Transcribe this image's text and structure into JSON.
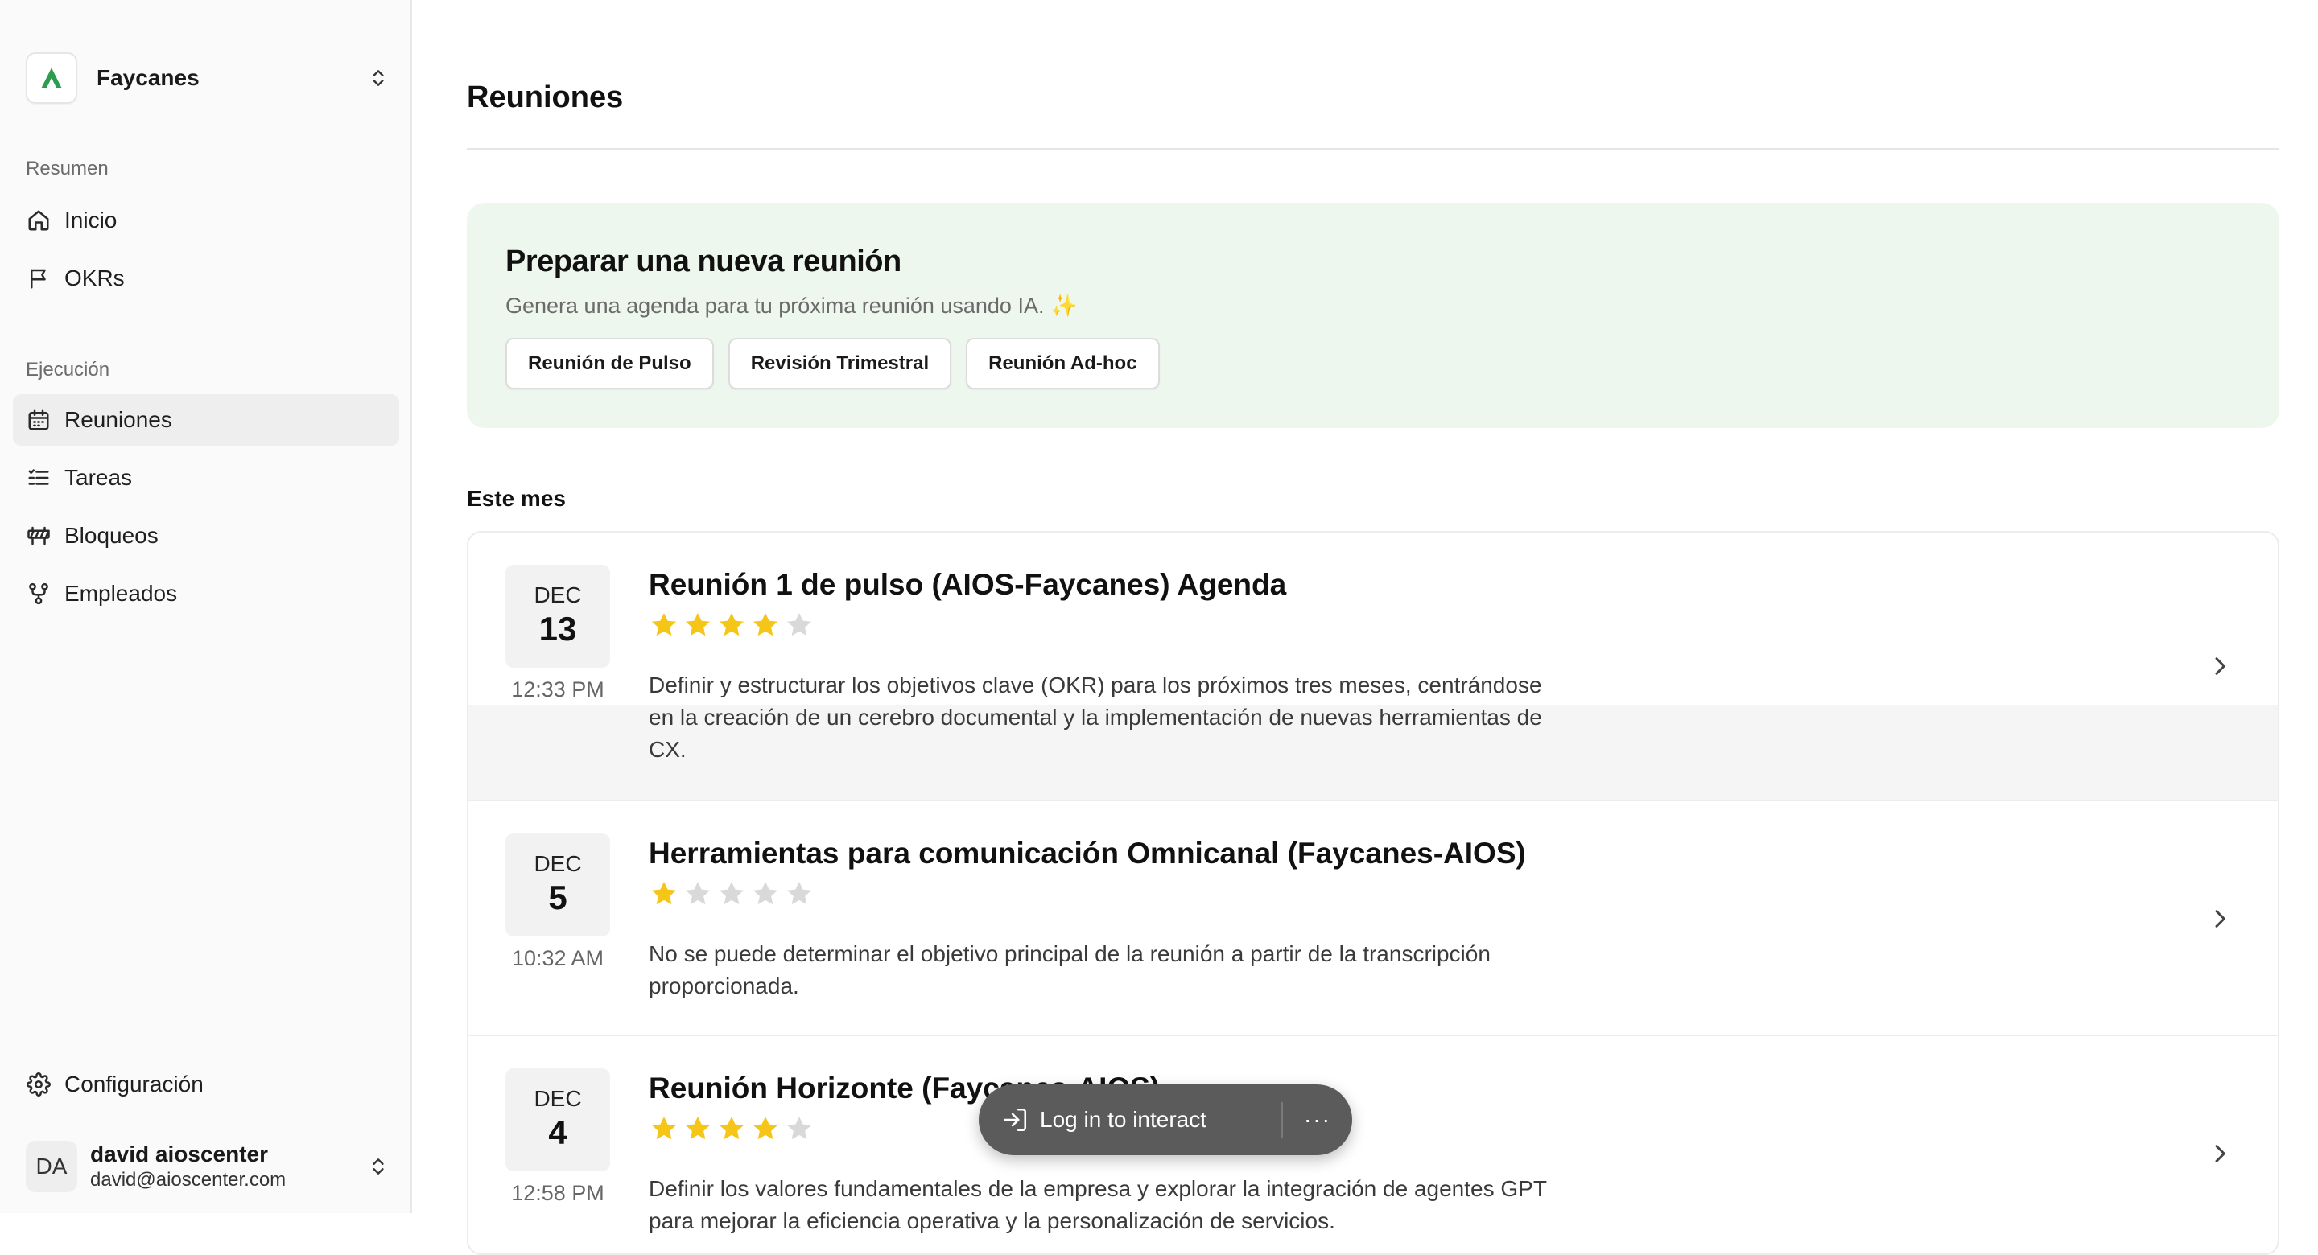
{
  "org": {
    "name": "Faycanes"
  },
  "sidebar": {
    "sections": [
      {
        "label": "Resumen",
        "items": [
          {
            "label": "Inicio",
            "icon": "home-icon"
          },
          {
            "label": "OKRs",
            "icon": "flag-icon"
          }
        ]
      },
      {
        "label": "Ejecución",
        "items": [
          {
            "label": "Reuniones",
            "icon": "calendar-icon",
            "active": true
          },
          {
            "label": "Tareas",
            "icon": "list-check-icon"
          },
          {
            "label": "Bloqueos",
            "icon": "roadblock-icon"
          },
          {
            "label": "Empleados",
            "icon": "org-tree-icon"
          }
        ]
      }
    ],
    "settings_label": "Configuración",
    "user": {
      "initials": "DA",
      "name": "david aioscenter",
      "email": "david@aioscenter.com"
    }
  },
  "main": {
    "title": "Reuniones",
    "prepare": {
      "title": "Preparar una nueva reunión",
      "subtitle": "Genera una agenda para tu próxima reunión usando IA. ✨",
      "buttons": [
        "Reunión de Pulso",
        "Revisión Trimestral",
        "Reunión Ad-hoc"
      ]
    },
    "month_label": "Este mes",
    "meetings": [
      {
        "month": "DEC",
        "day": "13",
        "time": "12:33 PM",
        "title": "Reunión 1 de pulso (AIOS-Faycanes) Agenda",
        "rating": 4,
        "description": "Definir y estructurar los objetivos clave (OKR) para los próximos tres meses, centrándose en la creación de un cerebro documental y la implementación de nuevas herramientas de CX."
      },
      {
        "month": "DEC",
        "day": "5",
        "time": "10:32 AM",
        "title": "Herramientas para comunicación Omnicanal (Faycanes-AIOS)",
        "rating": 1,
        "description": "No se puede determinar el objetivo principal de la reunión a partir de la transcripción proporcionada."
      },
      {
        "month": "DEC",
        "day": "4",
        "time": "12:58 PM",
        "title": "Reunión Horizonte (Faycanes-AIOS)",
        "rating": 4,
        "description": "Definir los valores fundamentales de la empresa y explorar la integración de agentes GPT para mejorar la eficiencia operativa y la personalización de servicios."
      }
    ]
  },
  "overlay": {
    "login_label": "Log in to interact",
    "more_label": "···"
  },
  "colors": {
    "accent_green": "#2e9c4e",
    "star_filled": "#f5c518",
    "star_empty": "#d9d9d9",
    "prepare_bg": "#eef7ee"
  }
}
